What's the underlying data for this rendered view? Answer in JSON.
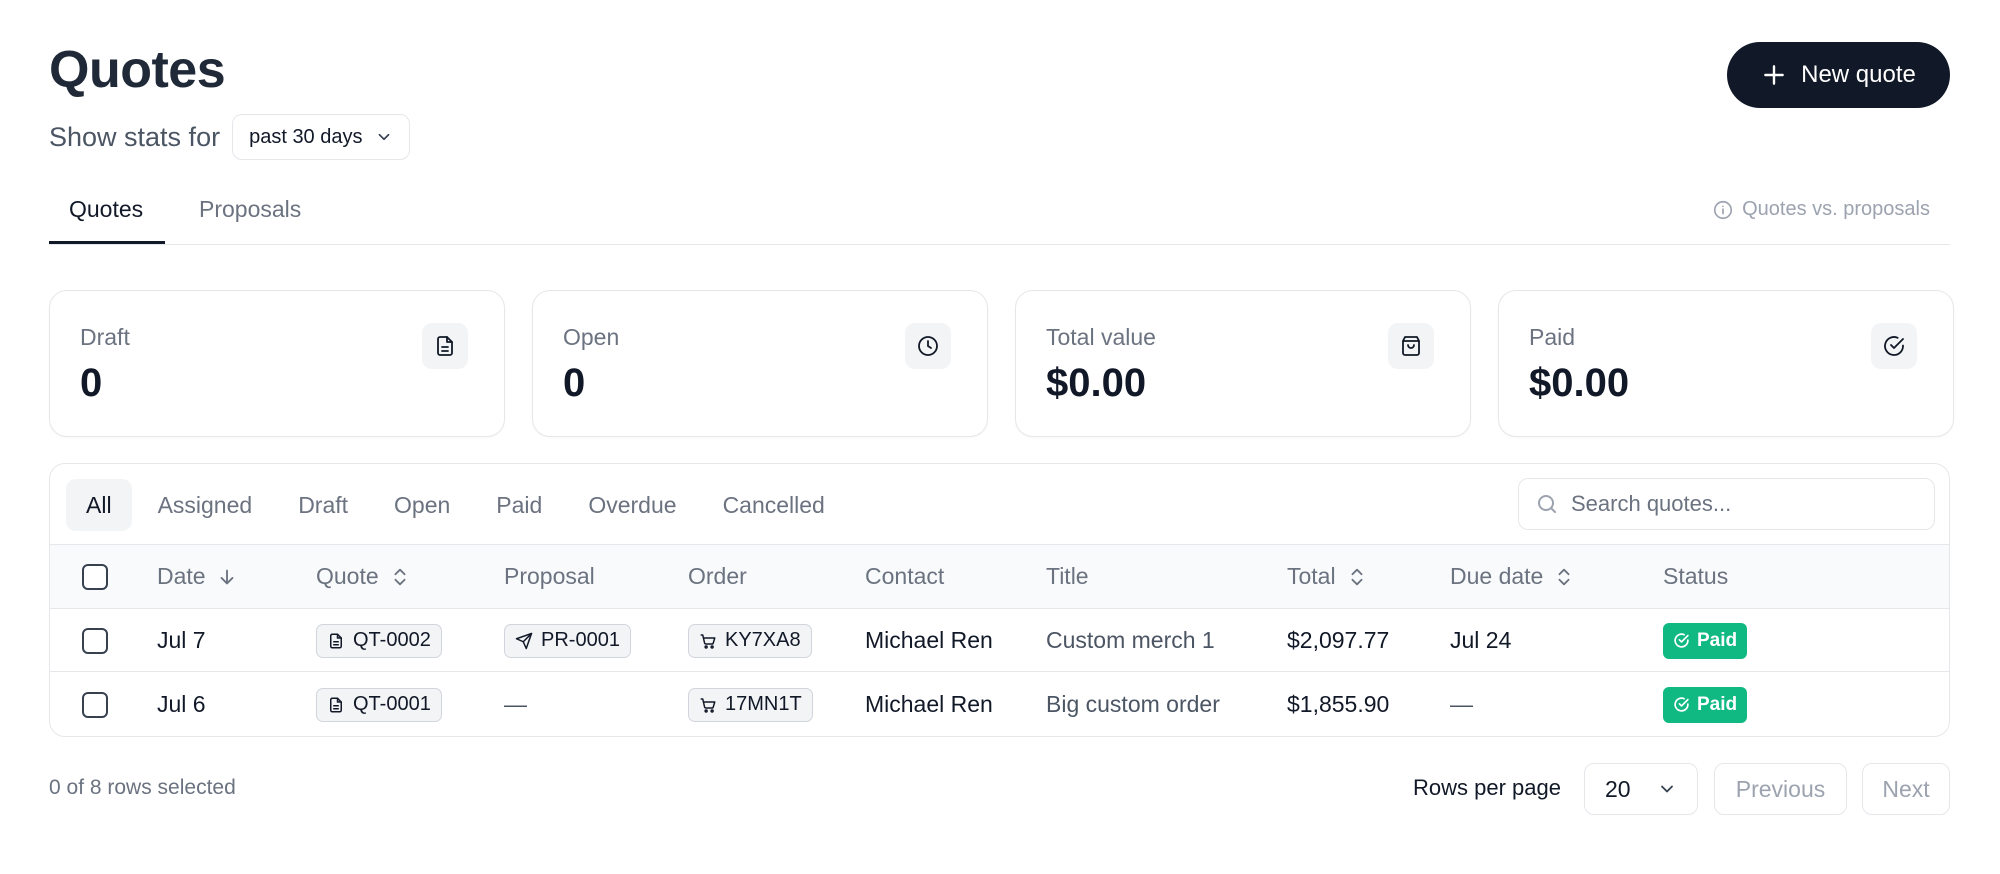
{
  "header": {
    "title": "Quotes",
    "stats_label": "Show stats for",
    "range_value": "past 30 days",
    "new_button_label": "New quote"
  },
  "tabs": [
    {
      "label": "Quotes",
      "active": true
    },
    {
      "label": "Proposals",
      "active": false
    }
  ],
  "help_link": "Quotes vs. proposals",
  "stats": [
    {
      "label": "Draft",
      "value": "0",
      "icon": "document-icon"
    },
    {
      "label": "Open",
      "value": "0",
      "icon": "clock-icon"
    },
    {
      "label": "Total value",
      "value": "$0.00",
      "icon": "shopping-bag-icon"
    },
    {
      "label": "Paid",
      "value": "$0.00",
      "icon": "check-circle-icon"
    }
  ],
  "filters": [
    "All",
    "Assigned",
    "Draft",
    "Open",
    "Paid",
    "Overdue",
    "Cancelled"
  ],
  "active_filter": "All",
  "search": {
    "placeholder": "Search quotes..."
  },
  "columns": {
    "date": "Date",
    "quote": "Quote",
    "proposal": "Proposal",
    "order": "Order",
    "contact": "Contact",
    "title": "Title",
    "total": "Total",
    "due_date": "Due date",
    "status": "Status"
  },
  "rows": [
    {
      "date": "Jul 7",
      "quote": "QT-0002",
      "proposal": "PR-0001",
      "order": "KY7XA8",
      "contact": "Michael Ren",
      "title": "Custom merch 1",
      "total": "$2,097.77",
      "due_date": "Jul 24",
      "status": "Paid"
    },
    {
      "date": "Jul 6",
      "quote": "QT-0001",
      "proposal": "—",
      "order": "17MN1T",
      "contact": "Michael Ren",
      "title": "Big custom order",
      "total": "$1,855.90",
      "due_date": "—",
      "status": "Paid"
    }
  ],
  "footer": {
    "selection": "0 of 8 rows selected",
    "rows_per_page_label": "Rows per page",
    "rows_per_page": "20",
    "previous": "Previous",
    "next": "Next"
  },
  "colors": {
    "primary": "#111827",
    "paid": "#10b981",
    "muted": "#6b7280"
  }
}
